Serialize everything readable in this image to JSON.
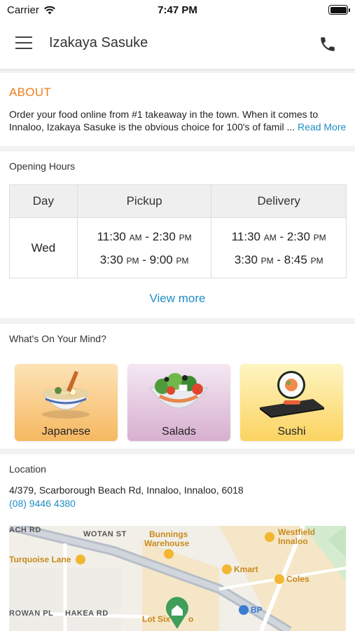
{
  "status_bar": {
    "carrier": "Carrier",
    "time": "7:47 PM"
  },
  "header": {
    "title": "Izakaya Sasuke",
    "menu_icon": "hamburger-icon",
    "phone_icon": "phone-icon"
  },
  "about": {
    "heading": "ABOUT",
    "text": "Order your food online from #1 takeaway in the town. When it comes to Innaloo, Izakaya Sasuke is the obvious choice for 100's of famil ...",
    "read_more": "Read More"
  },
  "hours": {
    "heading": "Opening Hours",
    "columns": [
      "Day",
      "Pickup",
      "Delivery"
    ],
    "rows": [
      {
        "day": "Wed",
        "pickup": [
          {
            "start": "11:30",
            "start_suffix": "AM",
            "end": "2:30",
            "end_suffix": "PM"
          },
          {
            "start": "3:30",
            "start_suffix": "PM",
            "end": "9:00",
            "end_suffix": "PM"
          }
        ],
        "delivery": [
          {
            "start": "11:30",
            "start_suffix": "AM",
            "end": "2:30",
            "end_suffix": "PM"
          },
          {
            "start": "3:30",
            "start_suffix": "PM",
            "end": "8:45",
            "end_suffix": "PM"
          }
        ]
      }
    ],
    "view_more": "View more"
  },
  "mind": {
    "heading": "What's On Your Mind?",
    "categories": [
      {
        "label": "Japanese",
        "icon": "ramen-bowl-icon"
      },
      {
        "label": "Salads",
        "icon": "salad-bowl-icon"
      },
      {
        "label": "Sushi",
        "icon": "sushi-roll-icon"
      }
    ]
  },
  "location": {
    "heading": "Location",
    "address": "4/379, Scarborough Beach Rd, Innaloo, Innaloo, 6018",
    "phone": "(08) 9446 4380",
    "map_labels": {
      "road_1": "ACH RD",
      "road_2": "WOTAN ST",
      "road_3": "ROWAN PL",
      "road_4": "HAKEA RD",
      "poi_1": "Bunnings",
      "poi_1b": "Warehouse",
      "poi_2": "Westfield",
      "poi_2b": "Innaloo",
      "poi_3": "Turquoise Lane",
      "poi_4": "Kmart",
      "poi_5": "Coles",
      "poi_6": "BP",
      "poi_7": "Lot Six",
      "poi_7b": "o"
    }
  },
  "colors": {
    "accent": "#ef7d1a",
    "link": "#1f8fc4",
    "marker": "#3f9e5a"
  }
}
